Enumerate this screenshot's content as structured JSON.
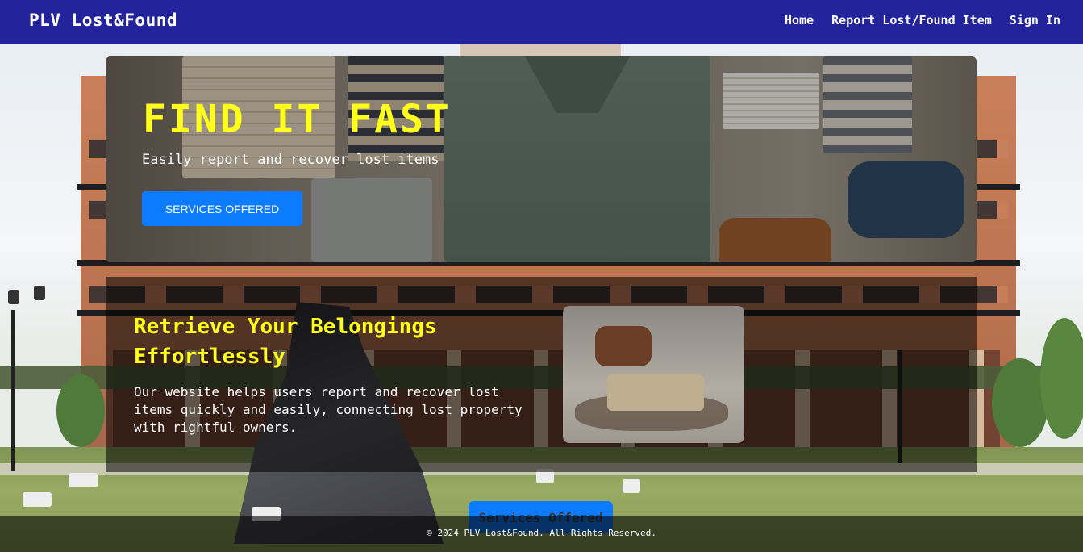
{
  "navbar": {
    "brand": "PLV Lost&Found",
    "links": [
      "Home",
      "Report Lost/Found Item",
      "Sign In"
    ]
  },
  "hero": {
    "title": "FIND IT FAST",
    "subtitle": "Easily report and recover lost items",
    "button_label": "SERVICES OFFERED"
  },
  "info": {
    "heading": "Retrieve Your Belongings Effortlessly",
    "body": "Our website helps users report and recover lost items quickly and easily, connecting lost property with rightful owners."
  },
  "floating_button": "Services Offered",
  "footer": "© 2024 PLV Lost&Found. All Rights Reserved.",
  "colors": {
    "navbar": "#23249c",
    "accent_yellow": "#ffff1a",
    "button_blue": "#0d7bff"
  }
}
